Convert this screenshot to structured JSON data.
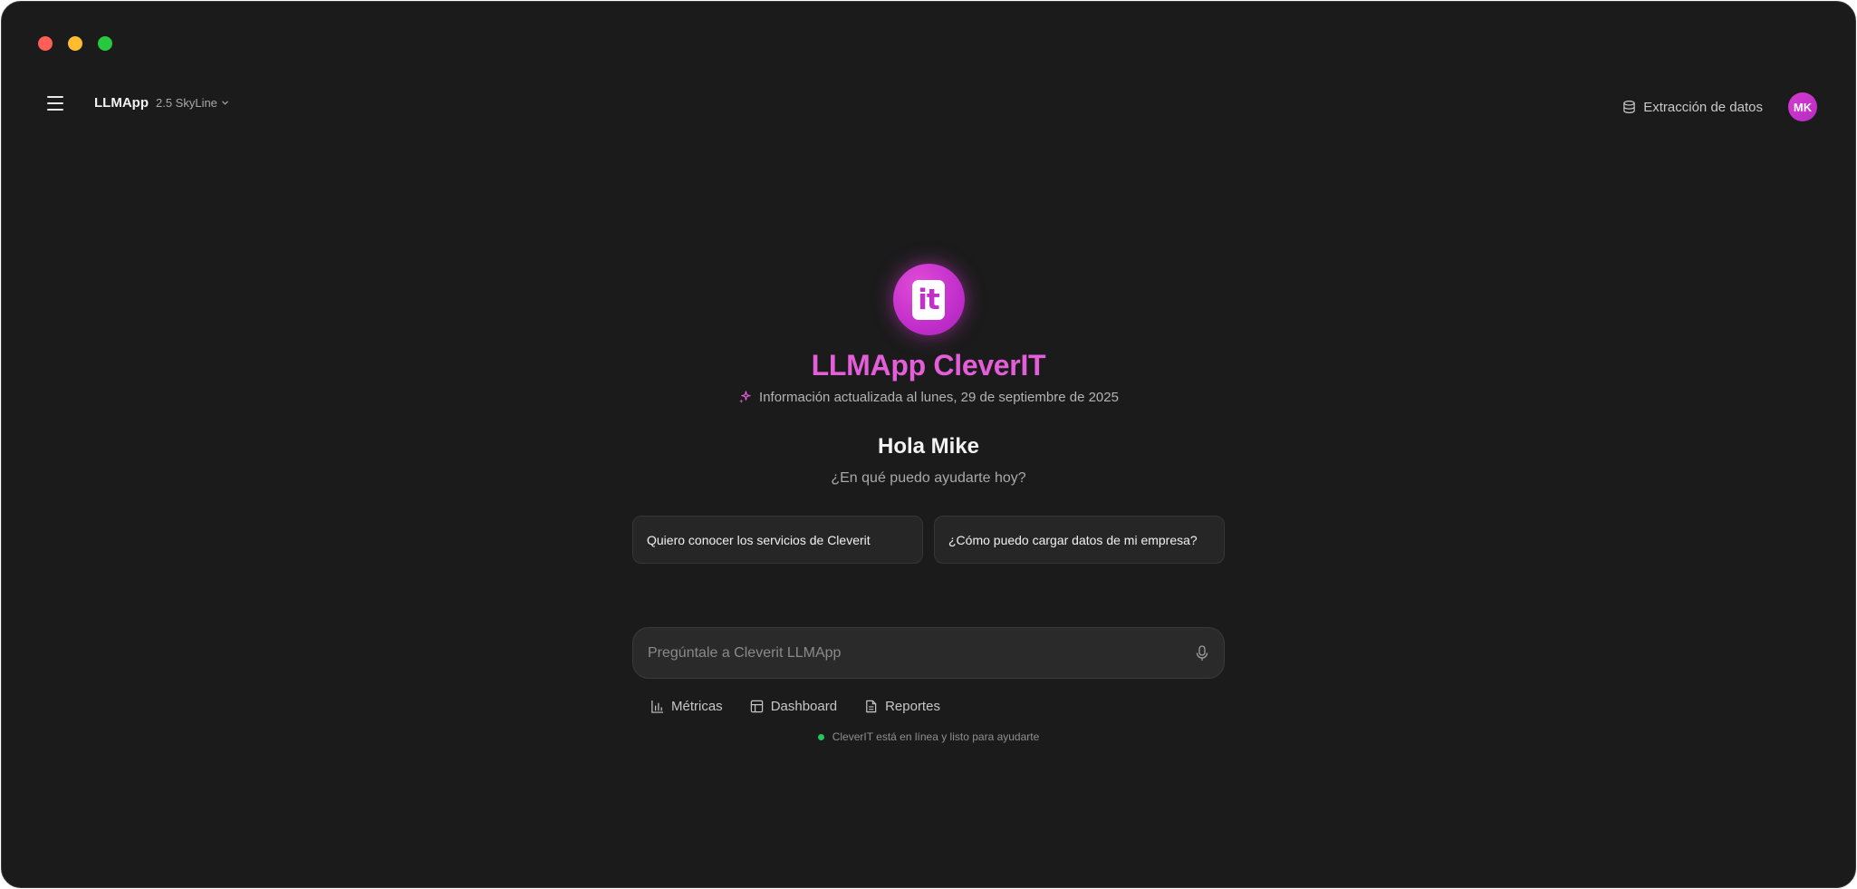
{
  "header": {
    "app_name": "LLMApp",
    "version": "2.5 SkyLine",
    "extract_label": "Extracción de datos",
    "avatar_initials": "MK"
  },
  "hero": {
    "logo_text": "it",
    "title": "LLMApp CleverIT",
    "updated": "Información actualizada al lunes, 29 de septiembre de 2025",
    "greeting": "Hola Mike",
    "subgreeting": "¿En qué puedo ayudarte hoy?"
  },
  "suggestions": [
    {
      "label": "Quiero conocer los servicios de Cleverit"
    },
    {
      "label": "¿Cómo puedo cargar datos de mi empresa?"
    }
  ],
  "prompt": {
    "placeholder": "Pregúntale a Cleverit LLMApp",
    "value": ""
  },
  "quick_actions": [
    {
      "label": "Métricas",
      "icon": "bar-chart-icon"
    },
    {
      "label": "Dashboard",
      "icon": "layout-icon"
    },
    {
      "label": "Reportes",
      "icon": "document-icon"
    }
  ],
  "status": {
    "text": "CleverIT está en línea y listo para ayudarte",
    "color": "#22c55e"
  },
  "colors": {
    "accent": "#d63bd0",
    "background": "#1b1b1b"
  }
}
